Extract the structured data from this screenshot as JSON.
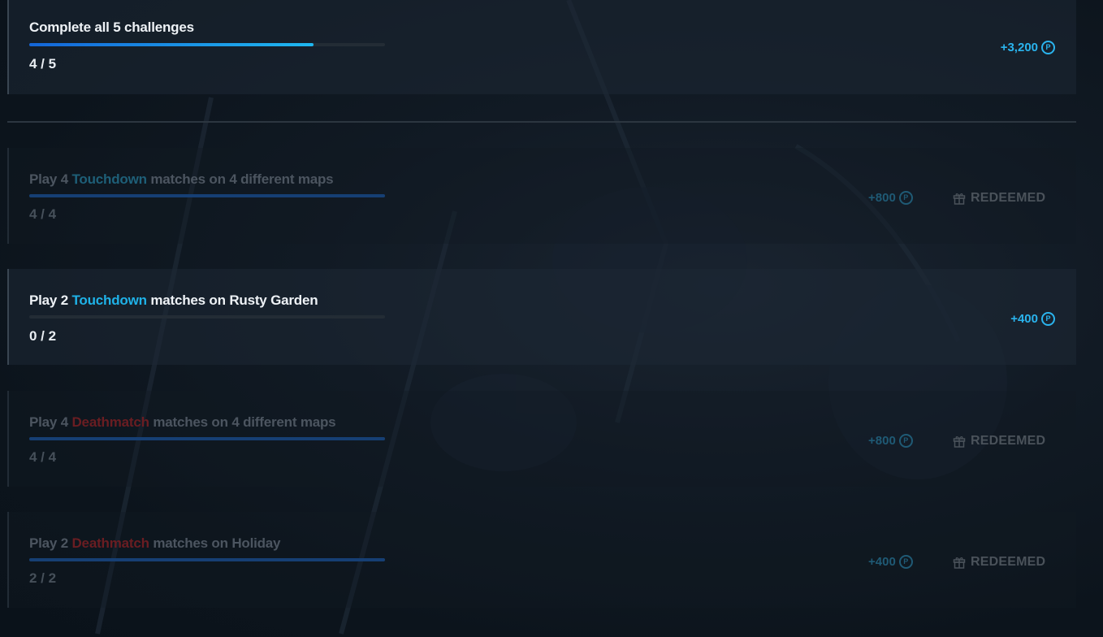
{
  "summary": {
    "title": "Complete all 5 challenges",
    "progress_text": "4 / 5",
    "progress": 0.8,
    "reward": "+3,200"
  },
  "challenges": [
    {
      "title_pre": "Play 4 ",
      "mode": "Touchdown",
      "title_post": " matches on 4 different maps",
      "progress_text": "4 / 4",
      "progress": 1.0,
      "reward": "+800",
      "status": "REDEEMED"
    },
    {
      "title_pre": "Play 2 ",
      "mode": "Touchdown",
      "title_post": " matches on Rusty Garden",
      "progress_text": "0 / 2",
      "progress": 0.0,
      "reward": "+400",
      "status": ""
    },
    {
      "title_pre": "Play 4 ",
      "mode": "Deathmatch",
      "title_post": " matches on 4 different maps",
      "progress_text": "4 / 4",
      "progress": 1.0,
      "reward": "+800",
      "status": "REDEEMED"
    },
    {
      "title_pre": "Play 2 ",
      "mode": "Deathmatch",
      "title_post": " matches on Holiday",
      "progress_text": "2 / 2",
      "progress": 1.0,
      "reward": "+400",
      "status": "REDEEMED"
    }
  ],
  "colors": {
    "accent": "#1fb2e8",
    "touchdown": "#1fb2e8",
    "deathmatch": "#6a1d22",
    "progress_fill": "#1465d8"
  },
  "icons": {
    "coin": "coin-icon",
    "gift": "gift-icon"
  }
}
